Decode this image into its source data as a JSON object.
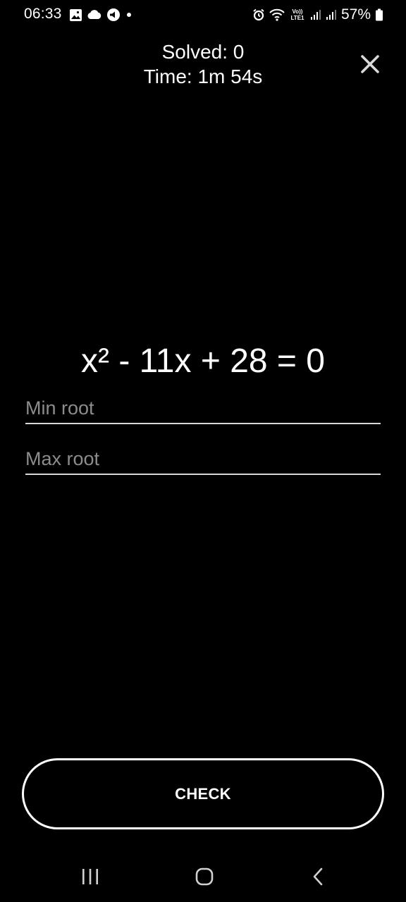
{
  "status_bar": {
    "time": "06:33",
    "battery_percent": "57%",
    "left_icons": [
      "gallery-icon",
      "cloud-icon",
      "media-icon",
      "dot-icon"
    ],
    "right_icons": [
      "alarm-icon",
      "wifi-icon",
      "volte-icon",
      "signal-icon",
      "signal-icon",
      "battery-icon"
    ],
    "volte_label": "Vo)) LTE1"
  },
  "header": {
    "solved": "Solved: 0",
    "time": "Time: 1m 54s",
    "close_icon": "close-icon"
  },
  "equation": "x² - 11x + 28 = 0",
  "inputs": {
    "min_root": {
      "placeholder": "Min root",
      "value": ""
    },
    "max_root": {
      "placeholder": "Max root",
      "value": ""
    }
  },
  "check_button": {
    "label": "CHECK"
  },
  "nav_bar": {
    "icons": [
      "recents-icon",
      "home-icon",
      "back-icon"
    ]
  },
  "colors": {
    "background": "#000000",
    "text": "#ffffff",
    "placeholder": "#8c8c8c",
    "underline": "#d8d8d8"
  }
}
